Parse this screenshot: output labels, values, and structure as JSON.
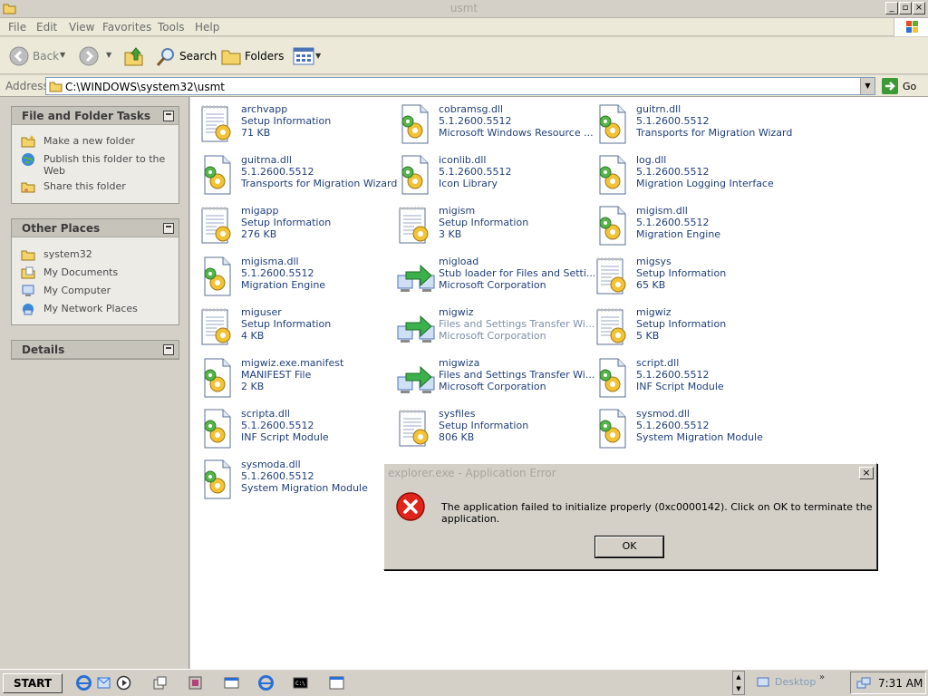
{
  "window": {
    "title": "usmt"
  },
  "menu": [
    "File",
    "Edit",
    "View",
    "Favorites",
    "Tools",
    "Help"
  ],
  "toolbar": {
    "back": "Back",
    "search": "Search",
    "folders": "Folders"
  },
  "address": {
    "label": "Address",
    "value": "C:\\WINDOWS\\system32\\usmt",
    "go": "Go"
  },
  "left_panels": {
    "tasks": {
      "title": "File and Folder Tasks",
      "items": [
        "Make a new folder",
        "Publish this folder to the Web",
        "Share this folder"
      ]
    },
    "places": {
      "title": "Other Places",
      "items": [
        "system32",
        "My Documents",
        "My Computer",
        "My Network Places"
      ]
    },
    "details": {
      "title": "Details"
    }
  },
  "files": [
    {
      "name": "archvapp",
      "line2": "Setup Information",
      "line3": "71 KB",
      "icon": "setup-inf-icon"
    },
    {
      "name": "cobramsg.dll",
      "line2": "5.1.2600.5512",
      "line3": "Microsoft Windows Resource ...",
      "icon": "dll-icon"
    },
    {
      "name": "guitrn.dll",
      "line2": "5.1.2600.5512",
      "line3": "Transports for Migration Wizard",
      "icon": "dll-icon"
    },
    {
      "name": "guitrna.dll",
      "line2": "5.1.2600.5512",
      "line3": "Transports for Migration Wizard",
      "icon": "dll-icon"
    },
    {
      "name": "iconlib.dll",
      "line2": "5.1.2600.5512",
      "line3": "Icon Library",
      "icon": "dll-icon"
    },
    {
      "name": "log.dll",
      "line2": "5.1.2600.5512",
      "line3": "Migration Logging Interface",
      "icon": "dll-icon"
    },
    {
      "name": "migapp",
      "line2": "Setup Information",
      "line3": "276 KB",
      "icon": "setup-inf-icon"
    },
    {
      "name": "migism",
      "line2": "Setup Information",
      "line3": "3 KB",
      "icon": "setup-inf-icon"
    },
    {
      "name": "migism.dll",
      "line2": "5.1.2600.5512",
      "line3": "Migration Engine",
      "icon": "dll-icon"
    },
    {
      "name": "migisma.dll",
      "line2": "5.1.2600.5512",
      "line3": "Migration Engine",
      "icon": "dll-icon"
    },
    {
      "name": "migload",
      "line2": "Stub loader for Files and Setti...",
      "line3": "Microsoft Corporation",
      "icon": "transfer-wizard-icon"
    },
    {
      "name": "migsys",
      "line2": "Setup Information",
      "line3": "65 KB",
      "icon": "setup-inf-icon"
    },
    {
      "name": "miguser",
      "line2": "Setup Information",
      "line3": "4 KB",
      "icon": "setup-inf-icon"
    },
    {
      "name": "migwiz",
      "line2": "Files and Settings Transfer Wi...",
      "line3": "Microsoft Corporation",
      "icon": "transfer-wizard-icon"
    },
    {
      "name": "migwiz",
      "line2": "Setup Information",
      "line3": "5 KB",
      "icon": "setup-inf-icon"
    },
    {
      "name": "migwiz.exe.manifest",
      "line2": "MANIFEST File",
      "line3": "2 KB",
      "icon": "dll-icon"
    },
    {
      "name": "migwiza",
      "line2": "Files and Settings Transfer Wi...",
      "line3": "Microsoft Corporation",
      "icon": "transfer-wizard-icon"
    },
    {
      "name": "script.dll",
      "line2": "5.1.2600.5512",
      "line3": "INF Script Module",
      "icon": "dll-icon"
    },
    {
      "name": "scripta.dll",
      "line2": "5.1.2600.5512",
      "line3": "INF Script Module",
      "icon": "dll-icon"
    },
    {
      "name": "sysfiles",
      "line2": "Setup Information",
      "line3": "806 KB",
      "icon": "setup-inf-icon"
    },
    {
      "name": "sysmod.dll",
      "line2": "5.1.2600.5512",
      "line3": "System Migration Module",
      "icon": "dll-icon"
    },
    {
      "name": "sysmoda.dll",
      "line2": "5.1.2600.5512",
      "line3": "System Migration Module",
      "icon": "dll-icon"
    }
  ],
  "dialog": {
    "title": "explorer.exe - Application Error",
    "message": "The application failed to initialize properly (0xc0000142). Click on OK to terminate the application.",
    "ok": "OK"
  },
  "taskbar": {
    "start": "START",
    "desktop": "Desktop",
    "clock": "7:31 AM"
  }
}
